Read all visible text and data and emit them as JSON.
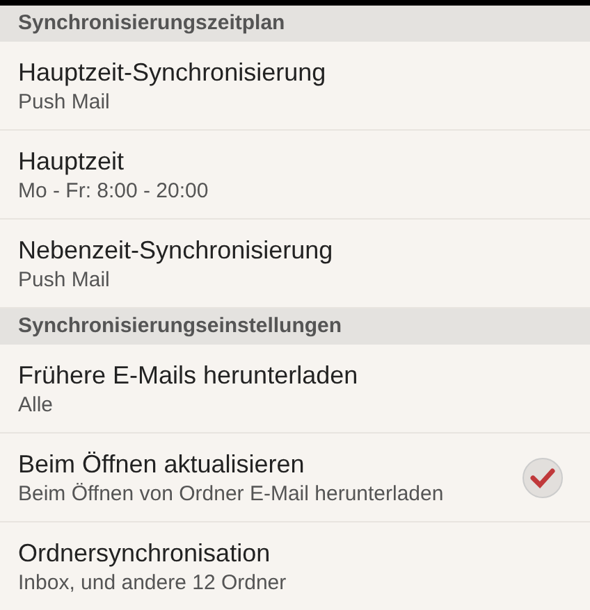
{
  "sections": [
    {
      "header": "Synchronisierungszeitplan",
      "items": [
        {
          "kind": "plain",
          "title": "Hauptzeit-Synchronisierung",
          "summary": "Push Mail"
        },
        {
          "kind": "plain",
          "title": "Hauptzeit",
          "summary": "Mo - Fr: 8:00 - 20:00"
        },
        {
          "kind": "plain",
          "title": "Nebenzeit-Synchronisierung",
          "summary": "Push Mail"
        }
      ]
    },
    {
      "header": "Synchronisierungseinstellungen",
      "items": [
        {
          "kind": "plain",
          "title": "Frühere E-Mails herunterladen",
          "summary": "Alle"
        },
        {
          "kind": "checkbox",
          "title": "Beim Öffnen aktualisieren",
          "summary": "Beim Öffnen von Ordner E-Mail herunterladen",
          "checked": true
        },
        {
          "kind": "plain",
          "title": "Ordnersynchronisation",
          "summary": "Inbox, und andere 12 Ordner"
        }
      ]
    }
  ]
}
